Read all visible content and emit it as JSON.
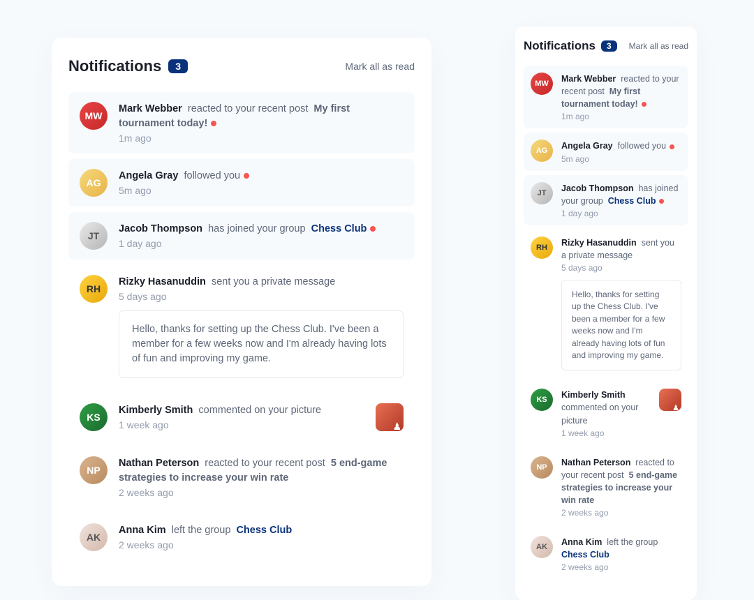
{
  "header": {
    "title": "Notifications",
    "count": "3",
    "mark_all": "Mark all as read"
  },
  "notifications": [
    {
      "name": "Mark Webber",
      "action": "reacted to your recent post",
      "target": "My first tournament today!",
      "target_link": false,
      "time": "1m ago",
      "unread": true,
      "avatar_class": "av-red",
      "initials": "MW"
    },
    {
      "name": "Angela Gray",
      "action": "followed you",
      "target": "",
      "target_link": false,
      "time": "5m ago",
      "unread": true,
      "avatar_class": "av-blonde",
      "initials": "AG"
    },
    {
      "name": "Jacob Thompson",
      "action": "has joined your group",
      "target": "Chess Club",
      "target_link": true,
      "time": "1 day ago",
      "unread": true,
      "avatar_class": "av-white",
      "initials": "JT"
    },
    {
      "name": "Rizky Hasanuddin",
      "action": "sent you a private message",
      "target": "",
      "target_link": false,
      "time": "5 days ago",
      "unread": false,
      "avatar_class": "av-yellow",
      "initials": "RH",
      "message": "Hello, thanks for setting up the Chess Club. I've been a member for a few weeks now and I'm already having lots of fun and improving my game."
    },
    {
      "name": "Kimberly Smith",
      "action": "commented on your picture",
      "target": "",
      "target_link": false,
      "time": "1 week ago",
      "unread": false,
      "avatar_class": "av-green",
      "initials": "KS",
      "has_thumb": true
    },
    {
      "name": "Nathan Peterson",
      "action": "reacted to your recent post",
      "target": "5 end-game strategies to increase your win rate",
      "target_link": false,
      "time": "2 weeks ago",
      "unread": false,
      "avatar_class": "av-tan",
      "initials": "NP"
    },
    {
      "name": "Anna Kim",
      "action": "left the group",
      "target": "Chess Club",
      "target_link": true,
      "time": "2 weeks ago",
      "unread": false,
      "avatar_class": "av-pale",
      "initials": "AK"
    }
  ]
}
